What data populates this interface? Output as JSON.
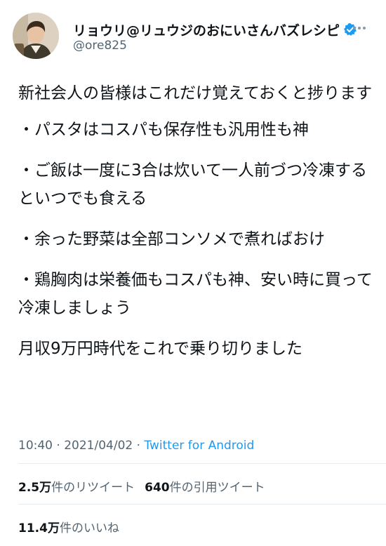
{
  "author": {
    "display_name": "リョウリ@リュウジのおにいさんバズレシピ",
    "handle": "@ore825",
    "avatar_icon": "person-avatar-icon",
    "verified_icon": "verified-badge-icon"
  },
  "tweet": {
    "paragraphs": [
      "新社会人の皆様はこれだけ覚えておくと捗ります",
      "・パスタはコスパも保存性も汎用性も神",
      "・ご飯は一度に3合は炊いて一人前づつ冷凍するといつでも食える",
      "・余った野菜は全部コンソメで煮ればおけ",
      "・鶏胸肉は栄養価もコスパも神、安い時に買って冷凍しましょう",
      "月収9万円時代をこれで乗り切りました"
    ]
  },
  "meta": {
    "time": "10:40",
    "separator": "·",
    "date": "2021/04/02",
    "source": "Twitter for Android"
  },
  "stats": {
    "retweets_count": "2.5万",
    "retweets_label": "件のリツイート",
    "quotes_count": "640",
    "quotes_label": "件の引用ツイート",
    "likes_count": "11.4万",
    "likes_label": "件のいいね"
  },
  "colors": {
    "accent": "#1d9bf0",
    "text": "#0f1419",
    "secondary": "#536471"
  }
}
